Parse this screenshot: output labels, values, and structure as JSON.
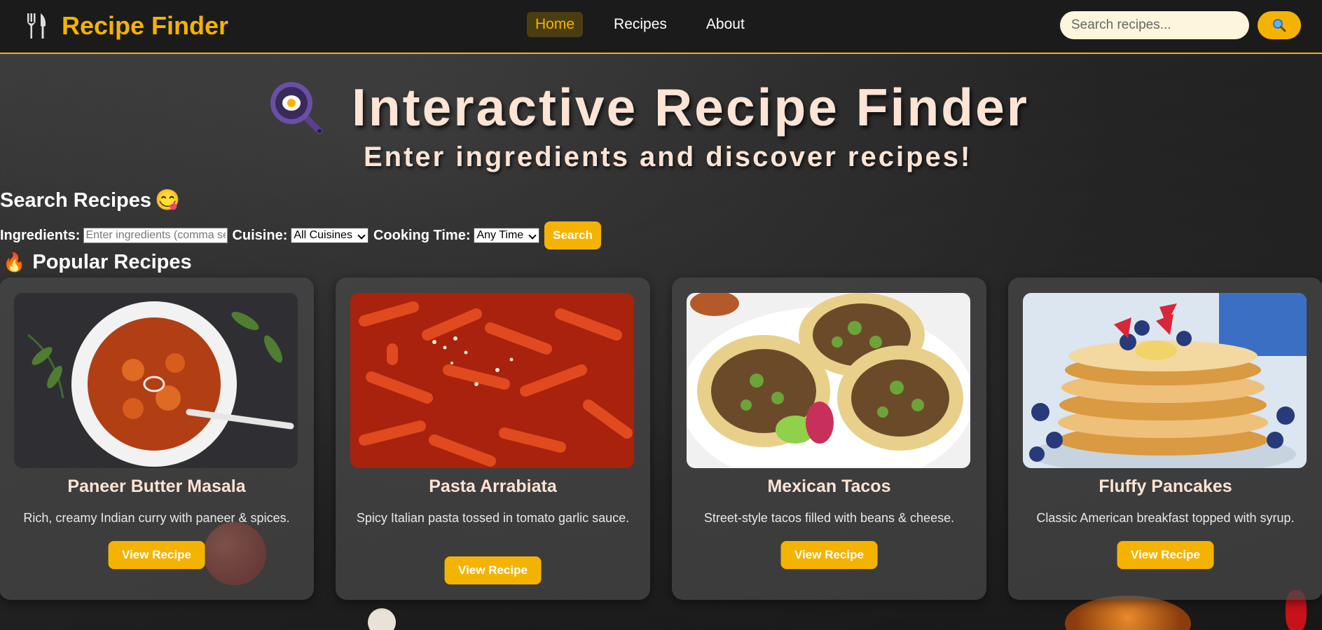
{
  "navbar": {
    "brand": "Recipe Finder",
    "brand_icon": "fork-knife-icon",
    "links": [
      {
        "label": "Home",
        "active": true
      },
      {
        "label": "Recipes",
        "active": false
      },
      {
        "label": "About",
        "active": false
      }
    ],
    "search_placeholder": "Search recipes...",
    "search_button_icon": "magnifier-icon",
    "accent_color": "#f5b301"
  },
  "hero": {
    "icon": "frying-pan-egg-icon",
    "title": "Interactive Recipe Finder",
    "subtitle": "Enter ingredients and discover recipes!"
  },
  "search_section": {
    "title": "Search Recipes",
    "title_emoji": "😋",
    "ingredients_label": "Ingredients:",
    "ingredients_placeholder": "Enter ingredients (comma separated)",
    "cuisine_label": "Cuisine:",
    "cuisine_selected": "All Cuisines",
    "time_label": "Cooking Time:",
    "time_selected": "Any Time",
    "search_button": "Search"
  },
  "popular": {
    "title": "Popular Recipes",
    "title_emoji": "🔥",
    "recipes": [
      {
        "title": "Paneer Butter Masala",
        "description": "Rich, creamy Indian curry with paneer & spices.",
        "button": "View Recipe"
      },
      {
        "title": "Pasta Arrabiata",
        "description": "Spicy Italian pasta tossed in tomato garlic sauce.",
        "button": "View Recipe"
      },
      {
        "title": "Mexican Tacos",
        "description": "Street-style tacos filled with beans & cheese.",
        "button": "View Recipe"
      },
      {
        "title": "Fluffy Pancakes",
        "description": "Classic American breakfast topped with syrup.",
        "button": "View Recipe"
      }
    ]
  }
}
